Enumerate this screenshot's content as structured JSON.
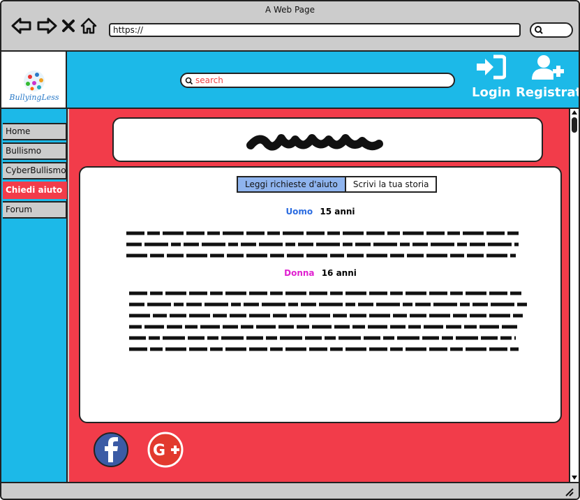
{
  "window": {
    "title": "A Web Page"
  },
  "address_bar": {
    "url": "https://"
  },
  "header": {
    "logo_text": "BullyingLess",
    "search_placeholder": "search",
    "login_label": "Login",
    "register_label": "Registrati"
  },
  "sidebar": {
    "items": [
      {
        "label": "Home"
      },
      {
        "label": "Bullismo"
      },
      {
        "label": "CyberBullismo"
      },
      {
        "label": "Chiedi aiuto",
        "active": true
      },
      {
        "label": "Forum"
      }
    ]
  },
  "tabs": [
    {
      "label": "Leggi richieste d'aiuto",
      "selected": true
    },
    {
      "label": "Scrivi la tua storia"
    }
  ],
  "stories": [
    {
      "gender": "Uomo",
      "age": "15 anni",
      "gender_color": "#2a6be0"
    },
    {
      "gender": "Donna",
      "age": "16 anni",
      "gender_color": "#e020d0"
    }
  ],
  "colors": {
    "header_bg": "#1cb9e8",
    "main_bg": "#f23c4a",
    "tab_selected": "#8fb4ee"
  },
  "social": [
    "facebook-icon",
    "google-plus-icon"
  ]
}
